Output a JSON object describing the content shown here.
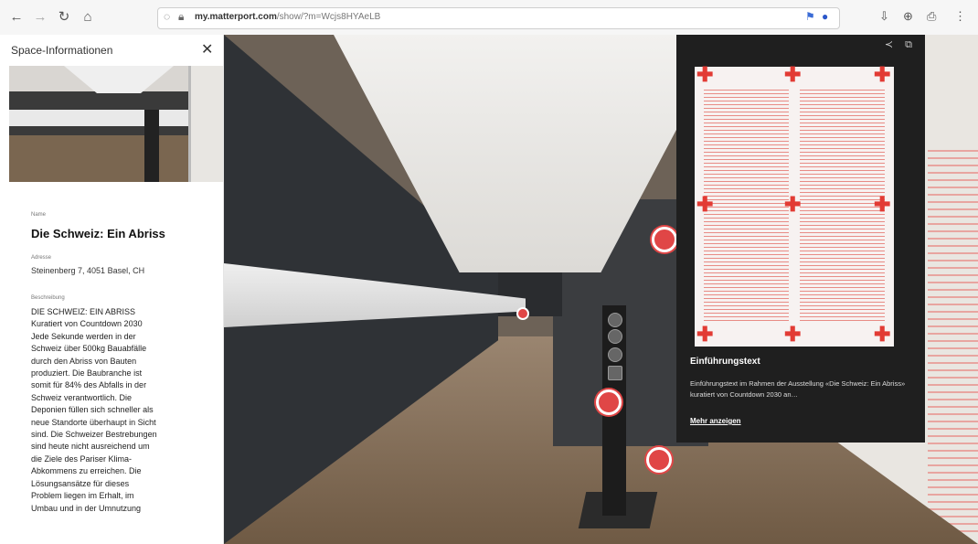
{
  "browser": {
    "back_glyph": "←",
    "forward_glyph": "→",
    "reload_glyph": "↻",
    "home_glyph": "⌂",
    "url_host": "my.matterport.com",
    "url_path": "/show/?m=Wcjs8HYAeLB",
    "ext_icons": [
      "⚑",
      "●",
      "⇩",
      "⊕",
      "⎙",
      "⋮"
    ]
  },
  "sidebar": {
    "header": "Space-Informationen",
    "close_glyph": "✕",
    "name_label": "Name",
    "title": "Die Schweiz: Ein Abriss",
    "address_label": "Adresse",
    "address": "Steinenberg 7, 4051 Basel, CH",
    "description_label": "Beschreibung",
    "description": "DIE SCHWEIZ: EIN ABRISS\nKuratiert von Countdown 2030\nJede Sekunde werden in der\nSchweiz über 500kg Bauabfälle\ndurch den Abriss von Bauten\nproduziert. Die Baubranche ist\nsomit für 84% des Abfalls in der\nSchweiz verantwortlich. Die\nDeponien füllen sich schneller als\nneue Standorte überhaupt in Sicht\nsind. Die Schweizer Bestrebungen\nsind heute nicht ausreichend um\ndie Ziele des Pariser Klima-\nAbkommens zu erreichen. Die\nLösungsansätze für dieses\nProblem liegen im Erhalt, im\nUmbau und in der Umnutzung"
  },
  "card": {
    "share_glyph": "≺",
    "fullscreen_glyph": "⧉",
    "title": "Einführungstext",
    "text": "Einführungstext im Rahmen der Ausstellung «Die Schweiz: Ein Abriss» kuratiert von Countdown 2030 an…",
    "more_label": "Mehr anzeigen"
  },
  "colors": {
    "accent": "#e04646"
  }
}
